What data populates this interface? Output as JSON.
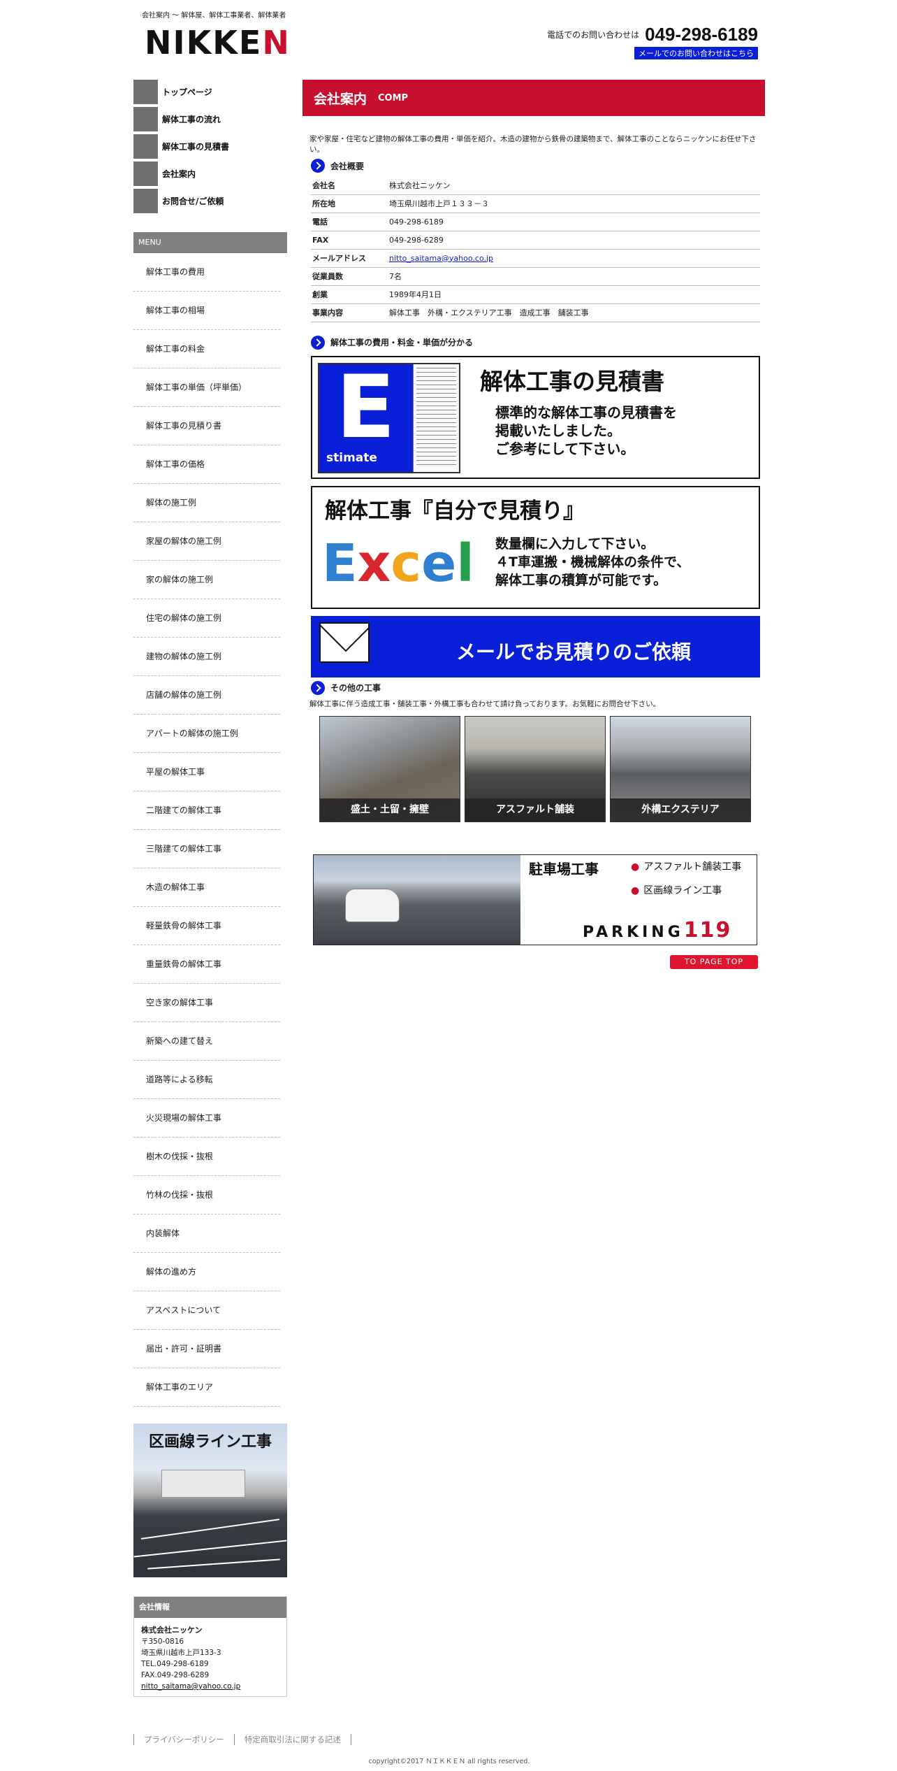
{
  "header": {
    "tagline": "会社案内 ～ 解体屋、解体工事業者、解体業者",
    "logo_pre": "NIKKE",
    "logo_red": "N",
    "tel_label": "電話でのお問い合わせは",
    "tel_number": "049-298-6189",
    "mail_link": "メールでのお問い合わせはこちら"
  },
  "gnav": [
    {
      "label": "トップページ"
    },
    {
      "label": "解体工事の流れ"
    },
    {
      "label": "解体工事の見積書"
    },
    {
      "label": "会社案内"
    },
    {
      "label": "お問合せ/ご依頼"
    }
  ],
  "menu": {
    "title": "MENU",
    "items": [
      "解体工事の費用",
      "解体工事の相場",
      "解体工事の料金",
      "解体工事の単価（坪単価）",
      "解体工事の見積り書",
      "解体工事の価格",
      "解体の施工例",
      "家屋の解体の施工例",
      "家の解体の施工例",
      "住宅の解体の施工例",
      "建物の解体の施工例",
      "店舗の解体の施工例",
      "アパートの解体の施工例",
      "平屋の解体工事",
      "二階建ての解体工事",
      "三階建ての解体工事",
      "木造の解体工事",
      "軽量鉄骨の解体工事",
      "重量鉄骨の解体工事",
      "空き家の解体工事",
      "新築への建て替え",
      "道路等による移転",
      "火災現場の解体工事",
      "樹木の伐採・抜根",
      "竹林の伐採・抜根",
      "内装解体",
      "解体の進め方",
      "アスベストについて",
      "届出・許可・証明書",
      "解体工事のエリア"
    ]
  },
  "side_banner": {
    "title": "区画線ライン工事"
  },
  "company_info": {
    "title": "会社情報",
    "name": "株式会社ニッケン",
    "zip": "〒350-0816",
    "address": "埼玉県川越市上戸133-3",
    "tel": "TEL.049-298-6189",
    "fax": "FAX.049-298-6289",
    "email": "nitto_saitama@yahoo.co.jp"
  },
  "main": {
    "title": "会社案内",
    "title_sub": "COMP",
    "intro": "家や家屋・住宅など建物の解体工事の費用・単価を紹介。木造の建物から鉄骨の建築物まで、解体工事のことならニッケンにお任せ下さい。",
    "overview_heading": "会社概要",
    "table": [
      {
        "k": "会社名",
        "v": "株式会社ニッケン"
      },
      {
        "k": "所在地",
        "v": "埼玉県川越市上戸１３３－３"
      },
      {
        "k": "電話",
        "v": "049-298-6189"
      },
      {
        "k": "FAX",
        "v": "049-298-6289"
      },
      {
        "k": "メールアドレス",
        "v": "nitto_saitama@yahoo.co.jp"
      },
      {
        "k": "従業員数",
        "v": "7名"
      },
      {
        "k": "創業",
        "v": "1989年4月1日"
      },
      {
        "k": "事業内容",
        "v": "解体工事　外構・エクステリア工事　造成工事　舗装工事"
      }
    ],
    "cost_heading": "解体工事の費用・料金・単価が分かる",
    "estimate_banner": {
      "big_letter": "E",
      "small": "stimate",
      "title": "解体工事の見積書",
      "line1": "標準的な解体工事の見積書を",
      "line2": "掲載いたしました。",
      "line3": "ご参考にして下さい。"
    },
    "excel_banner": {
      "title": "解体工事『自分で見積り』",
      "word": [
        "E",
        "x",
        "c",
        "e",
        "l"
      ],
      "line1": "数量欄に入力して下さい。",
      "line2": "４T車運搬・機械解体の条件で、",
      "line3": "解体工事の積算が可能です。"
    },
    "mail_banner": "メールでお見積りのご依頼",
    "other_heading": "その他の工事",
    "other_desc": "解体工事に伴う造成工事・舗装工事・外構工事も合わせて請け負っております。お気軽にお問合せ下さい。",
    "photos": [
      {
        "caption": "盛土・土留・擁壁"
      },
      {
        "caption": "アスファルト舗装"
      },
      {
        "caption": "外構エクステリア"
      }
    ],
    "parking": {
      "title": "駐車場工事",
      "item1": "アスファルト舗装工事",
      "item2": "区画線ライン工事",
      "logo": "PARKING",
      "logo_num": "119"
    },
    "page_top": "TO PAGE TOP"
  },
  "footer": {
    "link1": "プライバシーポリシー",
    "link2": "特定商取引法に関する記述",
    "copyright": "copyright©2017 ＮＩＫＫＥＮ all rights reserved."
  },
  "colors": {
    "accent_red": "#c8102e",
    "link_blue": "#0a20d8",
    "nav_gray": "#6f6f6f"
  }
}
